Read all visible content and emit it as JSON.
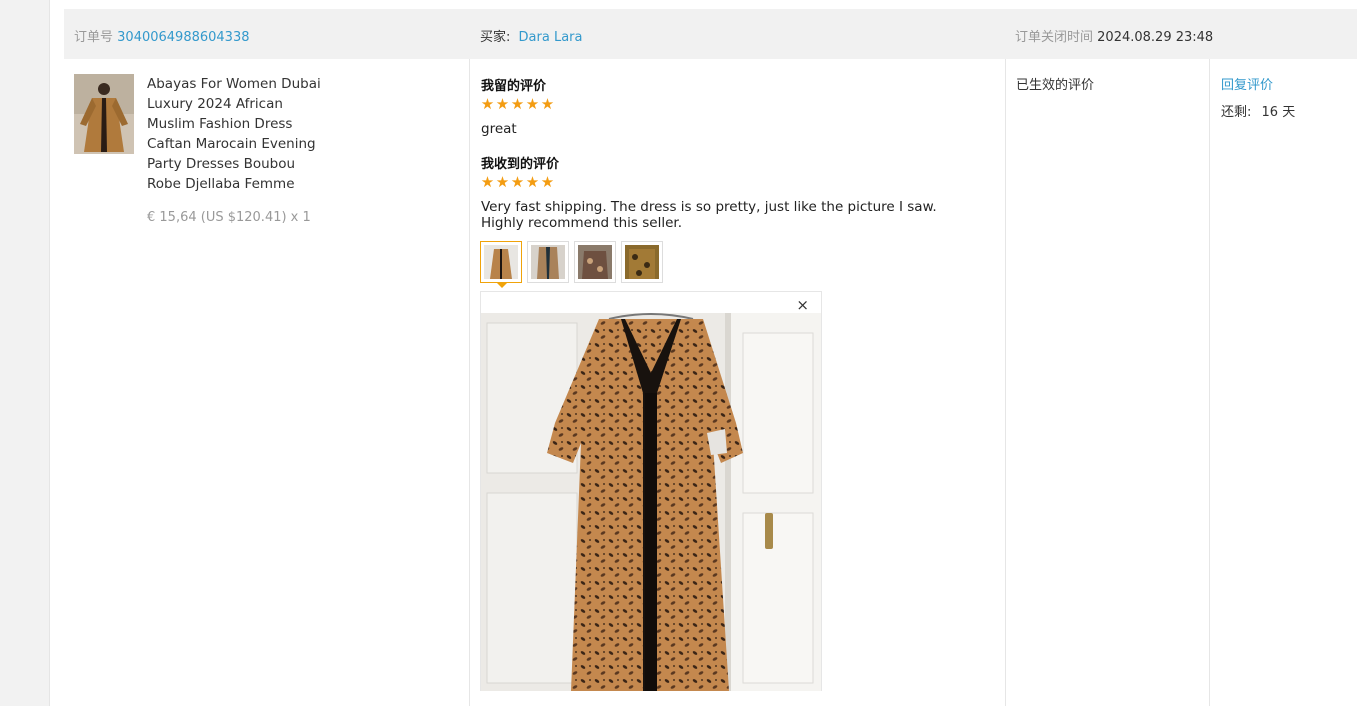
{
  "order": {
    "number_label": "订单号",
    "number": "3040064988604338",
    "buyer_label": "买家:",
    "buyer_name": "Dara Lara",
    "closed_label": "订单关闭时间",
    "closed_time": "2024.08.29 23:48"
  },
  "product": {
    "title": "Abayas For Women Dubai Luxury 2024 African Muslim Fashion Dress Caftan Marocain Evening Party Dresses Boubou Robe Djellaba Femme",
    "price": "€ 15,64 (US $120.41) x 1"
  },
  "my_review": {
    "label": "我留的评价",
    "rating": 5,
    "text": "great"
  },
  "received_review": {
    "label": "我收到的评价",
    "rating": 5,
    "text": "Very fast shipping. The dress is so pretty, just like the picture I saw. Highly recommend this seller."
  },
  "preview": {
    "close_icon": "×"
  },
  "status": {
    "text": "已生效的评价"
  },
  "actions": {
    "reply_label": "回复评价",
    "remaining_label": "还剩:",
    "remaining_value": "16 天"
  },
  "colors": {
    "link": "#3399cc",
    "star": "#f39c12",
    "active_thumb": "#f0a30a"
  }
}
